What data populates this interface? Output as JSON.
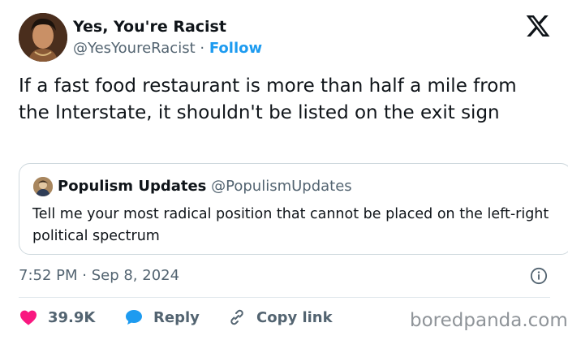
{
  "author": {
    "display_name": "Yes, You're Racist",
    "handle": "@YesYoureRacist",
    "separator": "·",
    "follow_label": "Follow"
  },
  "tweet": {
    "text": "If a fast food restaurant is more than half a mile from the Interstate, it shouldn't be listed on the exit sign"
  },
  "quoted": {
    "display_name": "Populism Updates",
    "handle": "@PopulismUpdates",
    "text": "Tell me your most radical position that cannot be placed on the left-right political spectrum"
  },
  "meta": {
    "timestamp": "7:52 PM · Sep 8, 2024"
  },
  "actions": {
    "like_count": "39.9K",
    "reply_label": "Reply",
    "copy_label": "Copy link"
  },
  "watermark": "boredpanda.com",
  "colors": {
    "accent": "#1d9bf0",
    "like": "#f91880",
    "text": "#0f1419",
    "muted": "#536471"
  },
  "icons": {
    "platform": "x-logo-icon",
    "like": "heart-icon",
    "reply": "speech-bubble-icon",
    "copy": "link-icon",
    "info": "info-icon"
  }
}
